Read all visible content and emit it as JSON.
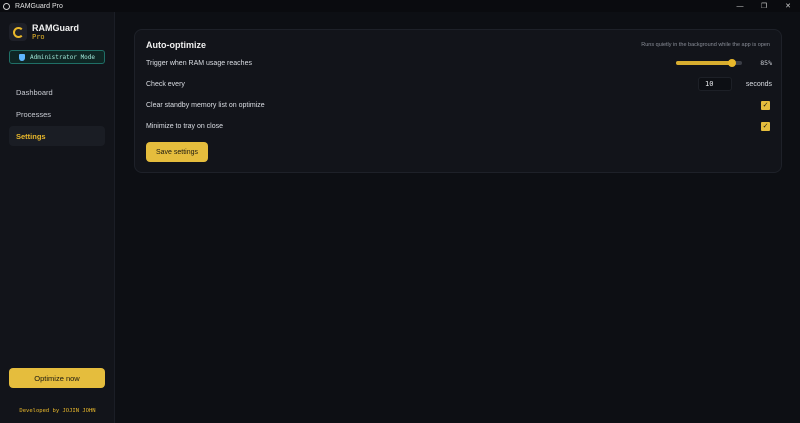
{
  "window": {
    "title": "RAMGuard Pro",
    "minimize_glyph": "—",
    "maximize_glyph": "❐",
    "close_glyph": "✕"
  },
  "sidebar": {
    "brand_name": "RAMGuard",
    "brand_sub": "Pro",
    "admin_badge": "Administrator Mode",
    "nav": [
      {
        "label": "Dashboard",
        "active": false
      },
      {
        "label": "Processes",
        "active": false
      },
      {
        "label": "Settings",
        "active": true
      }
    ],
    "optimize_label": "Optimize now",
    "credit": "Developed by JOJIN JOHN"
  },
  "settings": {
    "section_title": "Auto-optimize",
    "hint": "Runs quietly in the background while the app is open",
    "trigger": {
      "label": "Trigger when RAM usage reaches",
      "value": 85,
      "value_text": "85%"
    },
    "interval": {
      "label": "Check every",
      "value": "10",
      "unit": "seconds"
    },
    "clear_standby": {
      "label": "Clear standby memory list on optimize",
      "checked": true
    },
    "minimize_tray": {
      "label": "Minimize to tray on close",
      "checked": true
    },
    "save_label": "Save settings"
  },
  "colors": {
    "accent": "#e5bd3d",
    "background": "#0d0f14",
    "panel": "#12141a",
    "badge_border": "#1f6f66"
  },
  "icons": {
    "logo": "ring-gauge-icon",
    "badge": "shield-icon",
    "check": "checkmark-icon"
  }
}
